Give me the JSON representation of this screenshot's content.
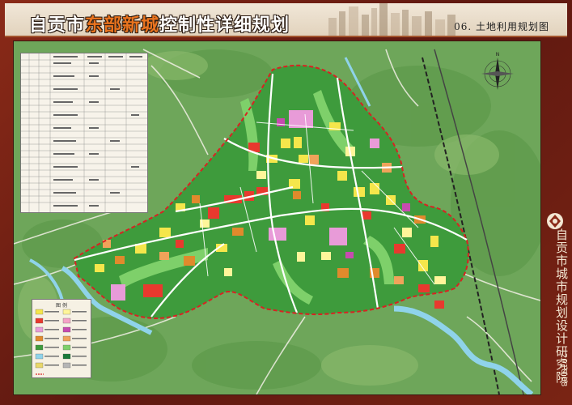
{
  "header": {
    "title_parts": [
      {
        "text": "自贡市",
        "tone": "white"
      },
      {
        "text": "东部新城",
        "tone": "orange"
      },
      {
        "text": "控制性详细规划",
        "tone": "white"
      }
    ],
    "subtitle": "06. 土地利用规划图"
  },
  "side": {
    "institute": "自贡市城市规划设计研究院",
    "date": "2018.08"
  },
  "map": {
    "legend_title": "图 例",
    "land_colors": {
      "residential": "#f5e64b",
      "residential_light": "#fff59a",
      "commercial": "#e8392e",
      "public_service": "#e89bd8",
      "industrial": "#e08a2c",
      "education": "#f0a35a",
      "green": "#3e9b3c",
      "green_light": "#7ed06a",
      "water": "#8fd3ea",
      "road": "#ffffff",
      "boundary": "#d82222"
    },
    "legend_swatches": [
      "#f5e64b",
      "#fff59a",
      "#e8392e",
      "#f5a2c7",
      "#e89bd8",
      "#c74bb0",
      "#e08a2c",
      "#f0a35a",
      "#3e9b3c",
      "#7ed06a",
      "#8fd3ea",
      "#1b7a3a",
      "#e9d76a",
      "#b5b5b5"
    ]
  }
}
